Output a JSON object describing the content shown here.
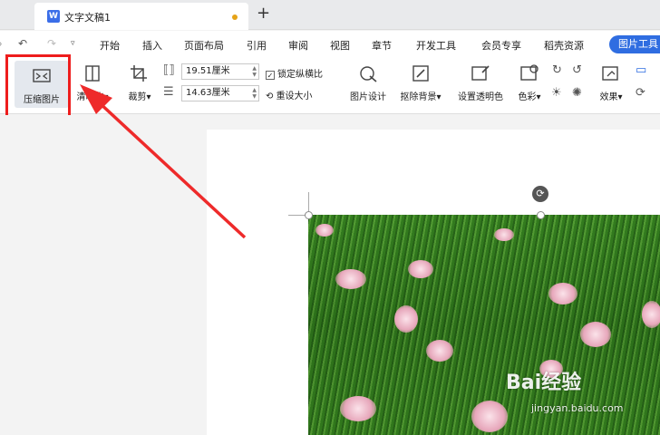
{
  "tab": {
    "title": "文字文稿1",
    "add_label": "+"
  },
  "menu": {
    "items": [
      "开始",
      "插入",
      "页面布局",
      "引用",
      "审阅",
      "视图",
      "章节",
      "开发工具",
      "会员专享",
      "稻壳资源"
    ],
    "picture_tools": "图片工具"
  },
  "ribbon": {
    "compress": "压缩图片",
    "clarify": "清晰化",
    "crop": "裁剪",
    "width": "19.51厘米",
    "height": "14.63厘米",
    "lock_ratio": "锁定纵横比",
    "reset_size": "重设大小",
    "picture_design": "图片设计",
    "remove_bg": "抠除背景",
    "set_transparent": "设置透明色",
    "color": "色彩",
    "effects": "效果"
  },
  "watermark": {
    "brand": "Bai经验",
    "site": "jingyan.baidu.com"
  },
  "colors": {
    "highlight": "#ee1d1d",
    "accent": "#2f6de1"
  }
}
